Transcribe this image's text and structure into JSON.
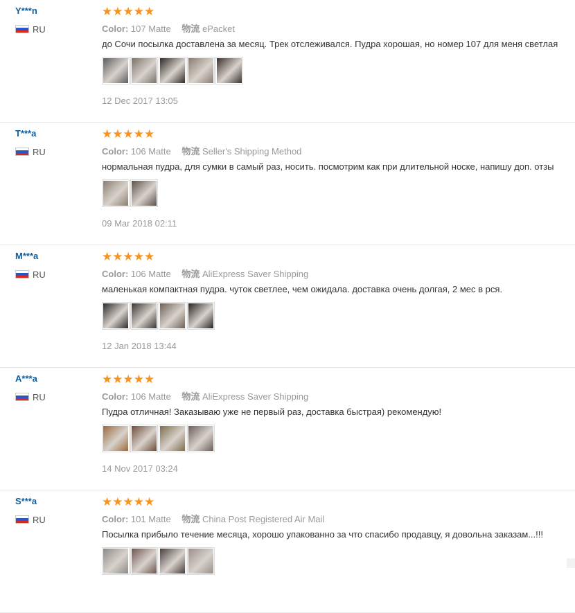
{
  "reviews": [
    {
      "user": "Y***n",
      "country": "RU",
      "stars": "★★★★★",
      "color_label": "Color:",
      "color_value": "107 Matte",
      "shipping_label": "物流",
      "shipping_value": "ePacket",
      "text": "до Сочи посылка доставлена за месяц. Трек отслеживался. Пудра хорошая, но номер 107 для меня светлая",
      "date": "12 Dec 2017 13:05",
      "thumbs": [
        "#5c5e63",
        "#7b7269",
        "#2f2a27",
        "#8a7b70",
        "#3b302c"
      ]
    },
    {
      "user": "T***a",
      "country": "RU",
      "stars": "★★★★★",
      "color_label": "Color:",
      "color_value": "106 Matte",
      "shipping_label": "物流",
      "shipping_value": "Seller's Shipping Method",
      "text": "нормальная пудра, для сумки в самый раз, носить. посмотрим как при длительной носке, напишу доп. отзы",
      "date": "09 Mar 2018 02:11",
      "thumbs": [
        "#8c7d6f",
        "#5d5047"
      ]
    },
    {
      "user": "M***a",
      "country": "RU",
      "stars": "★★★★★",
      "color_label": "Color:",
      "color_value": "106 Matte",
      "shipping_label": "物流",
      "shipping_value": "AliExpress Saver Shipping",
      "text": "маленькая компактная пудра. чуток светлее, чем ожидала. доставка очень долгая, 2 мес в рся.",
      "date": "12 Jan 2018 13:44",
      "thumbs": [
        "#2d2b2c",
        "#3a3433",
        "#6e6156",
        "#262424"
      ]
    },
    {
      "user": "A***a",
      "country": "RU",
      "stars": "★★★★★",
      "color_label": "Color:",
      "color_value": "106 Matte",
      "shipping_label": "物流",
      "shipping_value": "AliExpress Saver Shipping",
      "text": "Пудра отличная! Заказываю уже не первый раз, доставка быстрая) рекомендую!",
      "date": "14 Nov 2017 03:24",
      "thumbs": [
        "#9a6a3d",
        "#6d4c3a",
        "#7e6d4d",
        "#6b5e5a"
      ]
    },
    {
      "user": "S***a",
      "country": "RU",
      "stars": "★★★★★",
      "color_label": "Color:",
      "color_value": "101 Matte",
      "shipping_label": "物流",
      "shipping_value": "China Post Registered Air Mail",
      "text": "Посылка прибыло течение месяца, хорошо упакованно за что спасибо продавцу, я довольна заказам...!!!",
      "date": "",
      "thumbs": [
        "#8d8c88",
        "#6e5550",
        "#4a403e",
        "#9b8f8a"
      ]
    }
  ]
}
